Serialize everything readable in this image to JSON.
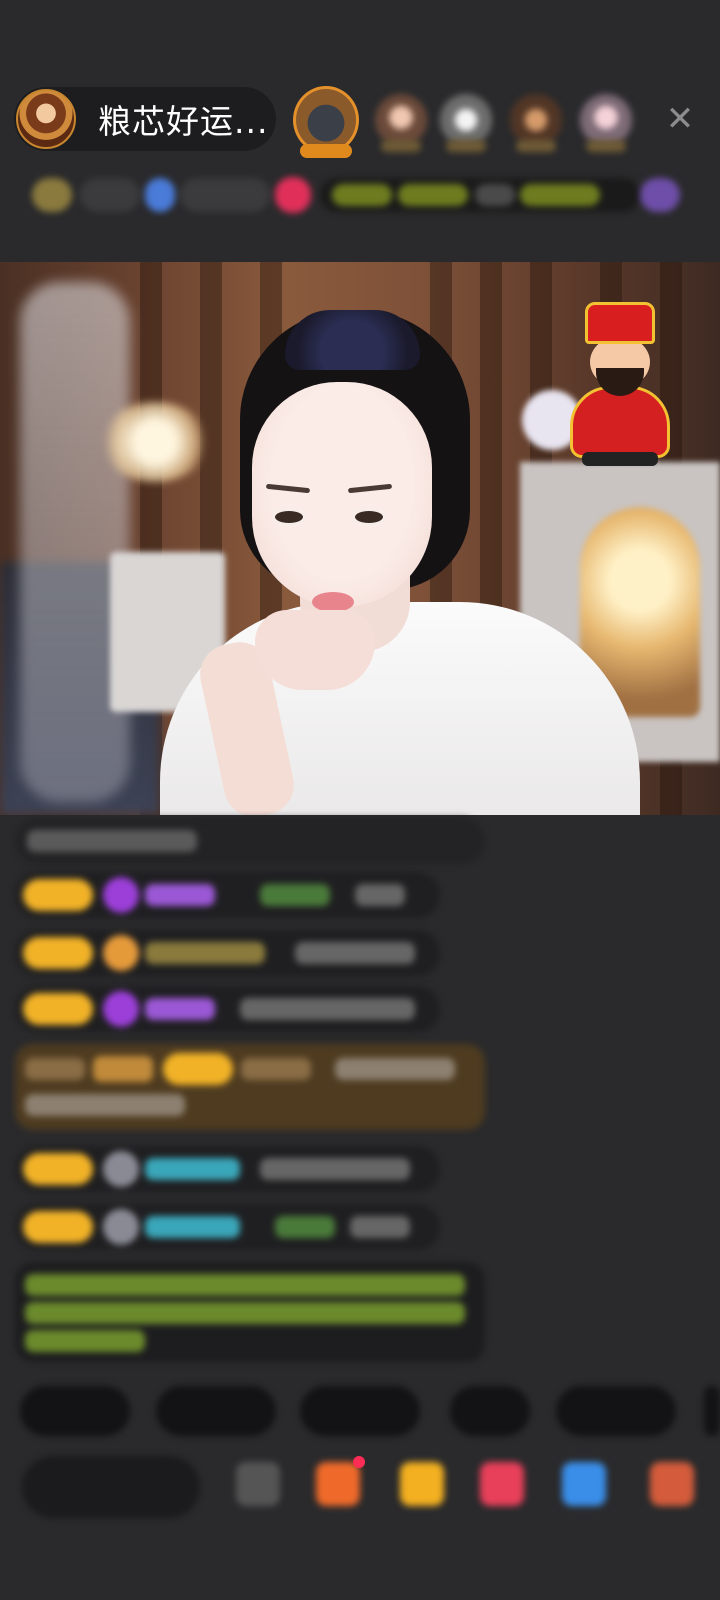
{
  "header": {
    "host_name": "粮芯好运..."
  },
  "icons": {
    "close": "close-icon",
    "chat_level_badge": "level-badge-icon",
    "diamond": "diamond-icon",
    "emoji": "emoji-icon",
    "gift": "gift-icon",
    "wish": "wish-icon",
    "fan_club": "fan-club-icon",
    "game": "game-icon",
    "more": "more-apps-icon"
  },
  "colors": {
    "background": "#2a2a2c",
    "level_badge": "#f1b227",
    "chat_bubble": "#1f1f21",
    "highlight_message": "#5a4323",
    "system_text": "#8fbf3a",
    "username_cyan": "#3aa6b9",
    "username_purple": "#9b58d6"
  }
}
